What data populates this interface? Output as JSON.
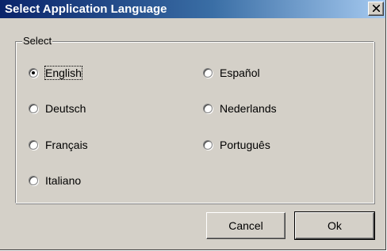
{
  "dialog": {
    "title": "Select Application Language",
    "close_icon": "close-icon"
  },
  "group": {
    "label": "Select",
    "selected": "English",
    "options": [
      {
        "label": "English",
        "checked": true
      },
      {
        "label": "Deutsch",
        "checked": false
      },
      {
        "label": "Français",
        "checked": false
      },
      {
        "label": "Italiano",
        "checked": false
      },
      {
        "label": "Español",
        "checked": false
      },
      {
        "label": "Nederlands",
        "checked": false
      },
      {
        "label": "Português",
        "checked": false
      }
    ]
  },
  "buttons": {
    "cancel": "Cancel",
    "ok": "Ok"
  },
  "colors": {
    "titlebar_start": "#0a246a",
    "titlebar_end": "#a6caf0",
    "face": "#d4d0c8"
  }
}
